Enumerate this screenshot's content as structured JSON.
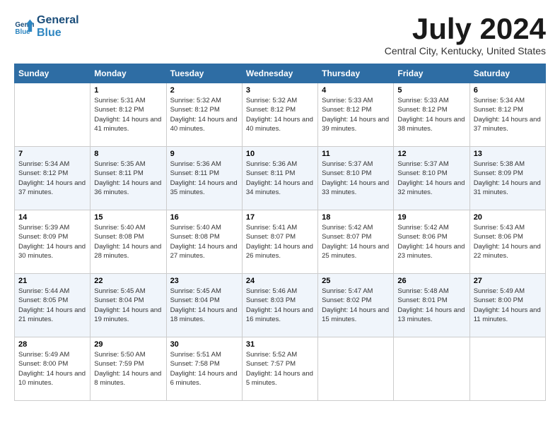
{
  "logo": {
    "line1": "General",
    "line2": "Blue"
  },
  "title": "July 2024",
  "location": "Central City, Kentucky, United States",
  "days_of_week": [
    "Sunday",
    "Monday",
    "Tuesday",
    "Wednesday",
    "Thursday",
    "Friday",
    "Saturday"
  ],
  "weeks": [
    [
      {
        "day": "",
        "sunrise": "",
        "sunset": "",
        "daylight": ""
      },
      {
        "day": "1",
        "sunrise": "Sunrise: 5:31 AM",
        "sunset": "Sunset: 8:12 PM",
        "daylight": "Daylight: 14 hours and 41 minutes."
      },
      {
        "day": "2",
        "sunrise": "Sunrise: 5:32 AM",
        "sunset": "Sunset: 8:12 PM",
        "daylight": "Daylight: 14 hours and 40 minutes."
      },
      {
        "day": "3",
        "sunrise": "Sunrise: 5:32 AM",
        "sunset": "Sunset: 8:12 PM",
        "daylight": "Daylight: 14 hours and 40 minutes."
      },
      {
        "day": "4",
        "sunrise": "Sunrise: 5:33 AM",
        "sunset": "Sunset: 8:12 PM",
        "daylight": "Daylight: 14 hours and 39 minutes."
      },
      {
        "day": "5",
        "sunrise": "Sunrise: 5:33 AM",
        "sunset": "Sunset: 8:12 PM",
        "daylight": "Daylight: 14 hours and 38 minutes."
      },
      {
        "day": "6",
        "sunrise": "Sunrise: 5:34 AM",
        "sunset": "Sunset: 8:12 PM",
        "daylight": "Daylight: 14 hours and 37 minutes."
      }
    ],
    [
      {
        "day": "7",
        "sunrise": "Sunrise: 5:34 AM",
        "sunset": "Sunset: 8:12 PM",
        "daylight": "Daylight: 14 hours and 37 minutes."
      },
      {
        "day": "8",
        "sunrise": "Sunrise: 5:35 AM",
        "sunset": "Sunset: 8:11 PM",
        "daylight": "Daylight: 14 hours and 36 minutes."
      },
      {
        "day": "9",
        "sunrise": "Sunrise: 5:36 AM",
        "sunset": "Sunset: 8:11 PM",
        "daylight": "Daylight: 14 hours and 35 minutes."
      },
      {
        "day": "10",
        "sunrise": "Sunrise: 5:36 AM",
        "sunset": "Sunset: 8:11 PM",
        "daylight": "Daylight: 14 hours and 34 minutes."
      },
      {
        "day": "11",
        "sunrise": "Sunrise: 5:37 AM",
        "sunset": "Sunset: 8:10 PM",
        "daylight": "Daylight: 14 hours and 33 minutes."
      },
      {
        "day": "12",
        "sunrise": "Sunrise: 5:37 AM",
        "sunset": "Sunset: 8:10 PM",
        "daylight": "Daylight: 14 hours and 32 minutes."
      },
      {
        "day": "13",
        "sunrise": "Sunrise: 5:38 AM",
        "sunset": "Sunset: 8:09 PM",
        "daylight": "Daylight: 14 hours and 31 minutes."
      }
    ],
    [
      {
        "day": "14",
        "sunrise": "Sunrise: 5:39 AM",
        "sunset": "Sunset: 8:09 PM",
        "daylight": "Daylight: 14 hours and 30 minutes."
      },
      {
        "day": "15",
        "sunrise": "Sunrise: 5:40 AM",
        "sunset": "Sunset: 8:08 PM",
        "daylight": "Daylight: 14 hours and 28 minutes."
      },
      {
        "day": "16",
        "sunrise": "Sunrise: 5:40 AM",
        "sunset": "Sunset: 8:08 PM",
        "daylight": "Daylight: 14 hours and 27 minutes."
      },
      {
        "day": "17",
        "sunrise": "Sunrise: 5:41 AM",
        "sunset": "Sunset: 8:07 PM",
        "daylight": "Daylight: 14 hours and 26 minutes."
      },
      {
        "day": "18",
        "sunrise": "Sunrise: 5:42 AM",
        "sunset": "Sunset: 8:07 PM",
        "daylight": "Daylight: 14 hours and 25 minutes."
      },
      {
        "day": "19",
        "sunrise": "Sunrise: 5:42 AM",
        "sunset": "Sunset: 8:06 PM",
        "daylight": "Daylight: 14 hours and 23 minutes."
      },
      {
        "day": "20",
        "sunrise": "Sunrise: 5:43 AM",
        "sunset": "Sunset: 8:06 PM",
        "daylight": "Daylight: 14 hours and 22 minutes."
      }
    ],
    [
      {
        "day": "21",
        "sunrise": "Sunrise: 5:44 AM",
        "sunset": "Sunset: 8:05 PM",
        "daylight": "Daylight: 14 hours and 21 minutes."
      },
      {
        "day": "22",
        "sunrise": "Sunrise: 5:45 AM",
        "sunset": "Sunset: 8:04 PM",
        "daylight": "Daylight: 14 hours and 19 minutes."
      },
      {
        "day": "23",
        "sunrise": "Sunrise: 5:45 AM",
        "sunset": "Sunset: 8:04 PM",
        "daylight": "Daylight: 14 hours and 18 minutes."
      },
      {
        "day": "24",
        "sunrise": "Sunrise: 5:46 AM",
        "sunset": "Sunset: 8:03 PM",
        "daylight": "Daylight: 14 hours and 16 minutes."
      },
      {
        "day": "25",
        "sunrise": "Sunrise: 5:47 AM",
        "sunset": "Sunset: 8:02 PM",
        "daylight": "Daylight: 14 hours and 15 minutes."
      },
      {
        "day": "26",
        "sunrise": "Sunrise: 5:48 AM",
        "sunset": "Sunset: 8:01 PM",
        "daylight": "Daylight: 14 hours and 13 minutes."
      },
      {
        "day": "27",
        "sunrise": "Sunrise: 5:49 AM",
        "sunset": "Sunset: 8:00 PM",
        "daylight": "Daylight: 14 hours and 11 minutes."
      }
    ],
    [
      {
        "day": "28",
        "sunrise": "Sunrise: 5:49 AM",
        "sunset": "Sunset: 8:00 PM",
        "daylight": "Daylight: 14 hours and 10 minutes."
      },
      {
        "day": "29",
        "sunrise": "Sunrise: 5:50 AM",
        "sunset": "Sunset: 7:59 PM",
        "daylight": "Daylight: 14 hours and 8 minutes."
      },
      {
        "day": "30",
        "sunrise": "Sunrise: 5:51 AM",
        "sunset": "Sunset: 7:58 PM",
        "daylight": "Daylight: 14 hours and 6 minutes."
      },
      {
        "day": "31",
        "sunrise": "Sunrise: 5:52 AM",
        "sunset": "Sunset: 7:57 PM",
        "daylight": "Daylight: 14 hours and 5 minutes."
      },
      {
        "day": "",
        "sunrise": "",
        "sunset": "",
        "daylight": ""
      },
      {
        "day": "",
        "sunrise": "",
        "sunset": "",
        "daylight": ""
      },
      {
        "day": "",
        "sunrise": "",
        "sunset": "",
        "daylight": ""
      }
    ]
  ]
}
